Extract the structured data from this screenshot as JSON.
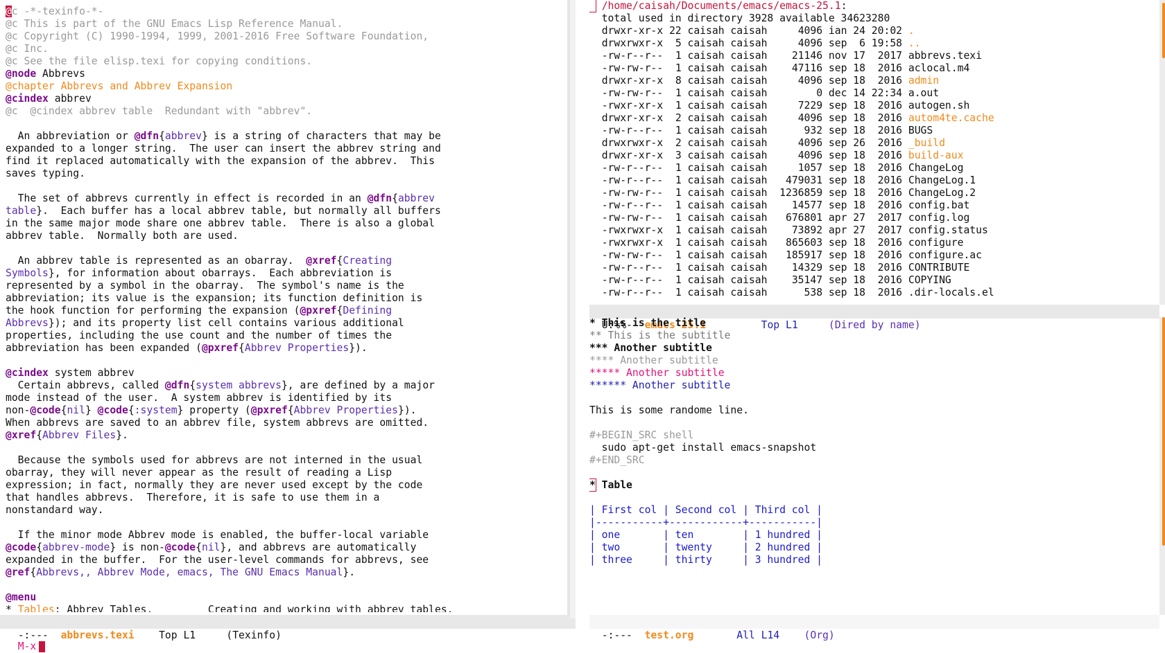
{
  "left_buffer": {
    "lines": [
      [
        {
          "t": "@",
          "c": "cursor"
        },
        {
          "t": "c -*-texinfo-*-",
          "c": "c-comment"
        }
      ],
      [
        {
          "t": "@c This is part of the GNU Emacs Lisp Reference Manual.",
          "c": "c-comment"
        }
      ],
      [
        {
          "t": "@c Copyright (C) 1990-1994, 1999, 2001-2016 Free Software Foundation,",
          "c": "c-comment"
        }
      ],
      [
        {
          "t": "@c Inc.",
          "c": "c-comment"
        }
      ],
      [
        {
          "t": "@c See the file elisp.texi for copying conditions.",
          "c": "c-comment"
        }
      ],
      [
        {
          "t": "@node",
          "c": "c-kw"
        },
        {
          "t": " Abbrevs",
          "c": ""
        }
      ],
      [
        {
          "t": "@chapter Abbrevs and Abbrev Expansion",
          "c": "c-orange"
        }
      ],
      [
        {
          "t": "@cindex",
          "c": "c-kw"
        },
        {
          "t": " abbrev",
          "c": ""
        }
      ],
      [
        {
          "t": "@c  @cindex abbrev table  Redundant with \"abbrev\".",
          "c": "c-comment"
        }
      ],
      [
        {
          "t": "",
          "c": ""
        }
      ],
      [
        {
          "t": "  An abbreviation or ",
          "c": ""
        },
        {
          "t": "@dfn",
          "c": "c-kw"
        },
        {
          "t": "{",
          "c": ""
        },
        {
          "t": "abbrev",
          "c": "c-link"
        },
        {
          "t": "} is a string of characters that may be",
          "c": ""
        }
      ],
      [
        {
          "t": "expanded to a longer string.  The user can insert the abbrev string and",
          "c": ""
        }
      ],
      [
        {
          "t": "find it replaced automatically with the expansion of the abbrev.  This",
          "c": ""
        }
      ],
      [
        {
          "t": "saves typing.",
          "c": ""
        }
      ],
      [
        {
          "t": "",
          "c": ""
        }
      ],
      [
        {
          "t": "  The set of abbrevs currently in effect is recorded in an ",
          "c": ""
        },
        {
          "t": "@dfn",
          "c": "c-kw"
        },
        {
          "t": "{",
          "c": ""
        },
        {
          "t": "abbrev",
          "c": "c-link"
        }
      ],
      [
        {
          "t": "table",
          "c": "c-link"
        },
        {
          "t": "}.  Each buffer has a local abbrev table, but normally all buffers",
          "c": ""
        }
      ],
      [
        {
          "t": "in the same major mode share one abbrev table.  There is also a global",
          "c": ""
        }
      ],
      [
        {
          "t": "abbrev table.  Normally both are used.",
          "c": ""
        }
      ],
      [
        {
          "t": "",
          "c": ""
        }
      ],
      [
        {
          "t": "  An abbrev table is represented as an obarray.  ",
          "c": ""
        },
        {
          "t": "@xref",
          "c": "c-kw"
        },
        {
          "t": "{",
          "c": ""
        },
        {
          "t": "Creating",
          "c": "c-link"
        }
      ],
      [
        {
          "t": "Symbols",
          "c": "c-link"
        },
        {
          "t": "}, for information about obarrays.  Each abbreviation is",
          "c": ""
        }
      ],
      [
        {
          "t": "represented by a symbol in the obarray.  The symbol's name is the",
          "c": ""
        }
      ],
      [
        {
          "t": "abbreviation; its value is the expansion; its function definition is",
          "c": ""
        }
      ],
      [
        {
          "t": "the hook function for performing the expansion (",
          "c": ""
        },
        {
          "t": "@pxref",
          "c": "c-kw"
        },
        {
          "t": "{",
          "c": ""
        },
        {
          "t": "Defining",
          "c": "c-link"
        }
      ],
      [
        {
          "t": "Abbrevs",
          "c": "c-link"
        },
        {
          "t": "}); and its property list cell contains various additional",
          "c": ""
        }
      ],
      [
        {
          "t": "properties, including the use count and the number of times the",
          "c": ""
        }
      ],
      [
        {
          "t": "abbreviation has been expanded (",
          "c": ""
        },
        {
          "t": "@pxref",
          "c": "c-kw"
        },
        {
          "t": "{",
          "c": ""
        },
        {
          "t": "Abbrev Properties",
          "c": "c-link"
        },
        {
          "t": "}).",
          "c": ""
        }
      ],
      [
        {
          "t": "",
          "c": ""
        }
      ],
      [
        {
          "t": "@cindex",
          "c": "c-kw"
        },
        {
          "t": " system abbrev",
          "c": ""
        }
      ],
      [
        {
          "t": "  Certain abbrevs, called ",
          "c": ""
        },
        {
          "t": "@dfn",
          "c": "c-kw"
        },
        {
          "t": "{",
          "c": ""
        },
        {
          "t": "system abbrevs",
          "c": "c-link"
        },
        {
          "t": "}, are defined by a major",
          "c": ""
        }
      ],
      [
        {
          "t": "mode instead of the user.  A system abbrev is identified by its",
          "c": ""
        }
      ],
      [
        {
          "t": "non-",
          "c": ""
        },
        {
          "t": "@code",
          "c": "c-kw"
        },
        {
          "t": "{",
          "c": ""
        },
        {
          "t": "nil",
          "c": "c-link"
        },
        {
          "t": "} ",
          "c": ""
        },
        {
          "t": "@code",
          "c": "c-kw"
        },
        {
          "t": "{",
          "c": ""
        },
        {
          "t": ":system",
          "c": "c-link"
        },
        {
          "t": "} property (",
          "c": ""
        },
        {
          "t": "@pxref",
          "c": "c-kw"
        },
        {
          "t": "{",
          "c": ""
        },
        {
          "t": "Abbrev Properties",
          "c": "c-link"
        },
        {
          "t": "}).",
          "c": ""
        }
      ],
      [
        {
          "t": "When abbrevs are saved to an abbrev file, system abbrevs are omitted.",
          "c": ""
        }
      ],
      [
        {
          "t": "@xref",
          "c": "c-kw"
        },
        {
          "t": "{",
          "c": ""
        },
        {
          "t": "Abbrev Files",
          "c": "c-link"
        },
        {
          "t": "}.",
          "c": ""
        }
      ],
      [
        {
          "t": "",
          "c": ""
        }
      ],
      [
        {
          "t": "  Because the symbols used for abbrevs are not interned in the usual",
          "c": ""
        }
      ],
      [
        {
          "t": "obarray, they will never appear as the result of reading a Lisp",
          "c": ""
        }
      ],
      [
        {
          "t": "expression; in fact, normally they are never used except by the code",
          "c": ""
        }
      ],
      [
        {
          "t": "that handles abbrevs.  Therefore, it is safe to use them in a",
          "c": ""
        }
      ],
      [
        {
          "t": "nonstandard way.",
          "c": ""
        }
      ],
      [
        {
          "t": "",
          "c": ""
        }
      ],
      [
        {
          "t": "  If the minor mode Abbrev mode is enabled, the buffer-local variable",
          "c": ""
        }
      ],
      [
        {
          "t": "@code",
          "c": "c-kw"
        },
        {
          "t": "{",
          "c": ""
        },
        {
          "t": "abbrev-mode",
          "c": "c-link"
        },
        {
          "t": "} is non-",
          "c": ""
        },
        {
          "t": "@code",
          "c": "c-kw"
        },
        {
          "t": "{",
          "c": ""
        },
        {
          "t": "nil",
          "c": "c-link"
        },
        {
          "t": "}, and abbrevs are automatically",
          "c": ""
        }
      ],
      [
        {
          "t": "expanded in the buffer.  For the user-level commands for abbrevs, see",
          "c": ""
        }
      ],
      [
        {
          "t": "@ref",
          "c": "c-kw"
        },
        {
          "t": "{",
          "c": ""
        },
        {
          "t": "Abbrevs,, Abbrev Mode, emacs, The GNU Emacs Manual",
          "c": "c-link"
        },
        {
          "t": "}.",
          "c": ""
        }
      ],
      [
        {
          "t": "",
          "c": ""
        }
      ],
      [
        {
          "t": "@menu",
          "c": "c-kw"
        }
      ],
      [
        {
          "t": "* ",
          "c": ""
        },
        {
          "t": "Tables",
          "c": "c-orange"
        },
        {
          "t": ": Abbrev Tables.         Creating and working with abbrev tables.",
          "c": ""
        }
      ]
    ],
    "modeline": {
      "prefix": "-:---  ",
      "name": "abbrevs.texi",
      "position": "Top L1",
      "mode": "(Texinfo)"
    }
  },
  "dired_buffer": {
    "header_path": "/home/caisah/Documents/emacs/emacs-25.1",
    "header_suffix": ":",
    "total_line": "  total used in directory 3928 available 34623280",
    "entries": [
      {
        "perms": "drwxr-xr-x",
        "links": "22",
        "user": "caisah",
        "group": "caisah",
        "size": "4096",
        "date": "ian 24 20:02",
        "name": ".",
        "is_dir": true
      },
      {
        "perms": "drwxrwxr-x",
        "links": "5",
        "user": "caisah",
        "group": "caisah",
        "size": "4096",
        "date": "sep  6 19:58",
        "name": "..",
        "is_dir": true
      },
      {
        "perms": "-rw-r--r--",
        "links": "1",
        "user": "caisah",
        "group": "caisah",
        "size": "21146",
        "date": "nov 17  2017",
        "name": "abbrevs.texi",
        "is_dir": false
      },
      {
        "perms": "-rw-rw-r--",
        "links": "1",
        "user": "caisah",
        "group": "caisah",
        "size": "47116",
        "date": "sep 18  2016",
        "name": "aclocal.m4",
        "is_dir": false
      },
      {
        "perms": "drwxr-xr-x",
        "links": "8",
        "user": "caisah",
        "group": "caisah",
        "size": "4096",
        "date": "sep 18  2016",
        "name": "admin",
        "is_dir": true
      },
      {
        "perms": "-rw-rw-r--",
        "links": "1",
        "user": "caisah",
        "group": "caisah",
        "size": "0",
        "date": "dec 14 22:34",
        "name": "a.out",
        "is_dir": false
      },
      {
        "perms": "-rwxr-xr-x",
        "links": "1",
        "user": "caisah",
        "group": "caisah",
        "size": "7229",
        "date": "sep 18  2016",
        "name": "autogen.sh",
        "is_dir": false
      },
      {
        "perms": "drwxr-xr-x",
        "links": "2",
        "user": "caisah",
        "group": "caisah",
        "size": "4096",
        "date": "sep 18  2016",
        "name": "autom4te.cache",
        "is_dir": true
      },
      {
        "perms": "-rw-r--r--",
        "links": "1",
        "user": "caisah",
        "group": "caisah",
        "size": "932",
        "date": "sep 18  2016",
        "name": "BUGS",
        "is_dir": false
      },
      {
        "perms": "drwxrwxr-x",
        "links": "2",
        "user": "caisah",
        "group": "caisah",
        "size": "4096",
        "date": "sep 26  2016",
        "name": "_build",
        "is_dir": true
      },
      {
        "perms": "drwxr-xr-x",
        "links": "3",
        "user": "caisah",
        "group": "caisah",
        "size": "4096",
        "date": "sep 18  2016",
        "name": "build-aux",
        "is_dir": true
      },
      {
        "perms": "-rw-r--r--",
        "links": "1",
        "user": "caisah",
        "group": "caisah",
        "size": "1057",
        "date": "sep 18  2016",
        "name": "ChangeLog",
        "is_dir": false
      },
      {
        "perms": "-rw-r--r--",
        "links": "1",
        "user": "caisah",
        "group": "caisah",
        "size": "479031",
        "date": "sep 18  2016",
        "name": "ChangeLog.1",
        "is_dir": false
      },
      {
        "perms": "-rw-rw-r--",
        "links": "1",
        "user": "caisah",
        "group": "caisah",
        "size": "1236859",
        "date": "sep 18  2016",
        "name": "ChangeLog.2",
        "is_dir": false
      },
      {
        "perms": "-rw-r--r--",
        "links": "1",
        "user": "caisah",
        "group": "caisah",
        "size": "14577",
        "date": "sep 18  2016",
        "name": "config.bat",
        "is_dir": false
      },
      {
        "perms": "-rw-rw-r--",
        "links": "1",
        "user": "caisah",
        "group": "caisah",
        "size": "676801",
        "date": "apr 27  2017",
        "name": "config.log",
        "is_dir": false
      },
      {
        "perms": "-rwxrwxr-x",
        "links": "1",
        "user": "caisah",
        "group": "caisah",
        "size": "73892",
        "date": "apr 27  2017",
        "name": "config.status",
        "is_dir": false
      },
      {
        "perms": "-rwxrwxr-x",
        "links": "1",
        "user": "caisah",
        "group": "caisah",
        "size": "865603",
        "date": "sep 18  2016",
        "name": "configure",
        "is_dir": false
      },
      {
        "perms": "-rw-rw-r--",
        "links": "1",
        "user": "caisah",
        "group": "caisah",
        "size": "185917",
        "date": "sep 18  2016",
        "name": "configure.ac",
        "is_dir": false
      },
      {
        "perms": "-rw-r--r--",
        "links": "1",
        "user": "caisah",
        "group": "caisah",
        "size": "14329",
        "date": "sep 18  2016",
        "name": "CONTRIBUTE",
        "is_dir": false
      },
      {
        "perms": "-rw-r--r--",
        "links": "1",
        "user": "caisah",
        "group": "caisah",
        "size": "35147",
        "date": "sep 18  2016",
        "name": "COPYING",
        "is_dir": false
      },
      {
        "perms": "-rw-r--r--",
        "links": "1",
        "user": "caisah",
        "group": "caisah",
        "size": "538",
        "date": "sep 18  2016",
        "name": ".dir-locals.el",
        "is_dir": false
      }
    ],
    "modeline": {
      "prefix": "U:%%-  ",
      "name": "emacs-25.1",
      "position": "Top L1",
      "mode": "(Dired by name)"
    }
  },
  "org_buffer": {
    "lines": [
      [
        {
          "t": "* This is the title",
          "c": "c-bold"
        }
      ],
      [
        {
          "t": "** This is the subtitle",
          "c": "c-gray2"
        }
      ],
      [
        {
          "t": "*** Another subtitle",
          "c": "c-bold"
        }
      ],
      [
        {
          "t": "**** Another subtitle",
          "c": "c-dim"
        }
      ],
      [
        {
          "t": "***** Another subtitle",
          "c": "c-magenta"
        }
      ],
      [
        {
          "t": "****** Another subtitle",
          "c": "c-navy"
        }
      ],
      [
        {
          "t": "",
          "c": ""
        }
      ],
      [
        {
          "t": "This is some randome line.",
          "c": ""
        }
      ],
      [
        {
          "t": "",
          "c": ""
        }
      ],
      [
        {
          "t": "#+BEGIN_SRC shell",
          "c": "c-dim"
        }
      ],
      [
        {
          "t": "  sudo apt-get install emacs-snapshot",
          "c": ""
        }
      ],
      [
        {
          "t": "#+END_SRC",
          "c": "c-dim"
        }
      ],
      [
        {
          "t": "",
          "c": ""
        }
      ],
      [
        {
          "t": "*",
          "c": "cursor-box c-bold"
        },
        {
          "t": " Table",
          "c": "c-bold"
        }
      ],
      [
        {
          "t": "",
          "c": ""
        }
      ],
      [
        {
          "t": "| First col | Second col | Third col |",
          "c": "c-blue"
        }
      ],
      [
        {
          "t": "|-----------+------------+-----------|",
          "c": "c-blue"
        }
      ],
      [
        {
          "t": "| one       | ten        | 1 hundred |",
          "c": "c-blue"
        }
      ],
      [
        {
          "t": "| two       | twenty     | 2 hundred |",
          "c": "c-blue"
        }
      ],
      [
        {
          "t": "| three     | thirty     | 3 hundred |",
          "c": "c-blue"
        }
      ]
    ],
    "modeline": {
      "prefix": "-:---  ",
      "name": "test.org",
      "position": "All L14",
      "mode": "(Org)"
    }
  },
  "minibuffer": {
    "prompt": "M-x"
  },
  "colors": {
    "accent_orange": "#f08a1c",
    "keyword_purple": "#7a0c8a",
    "link_purple": "#5b2fb0",
    "table_blue": "#1a1acc",
    "cursor_red": "#c4153e"
  }
}
